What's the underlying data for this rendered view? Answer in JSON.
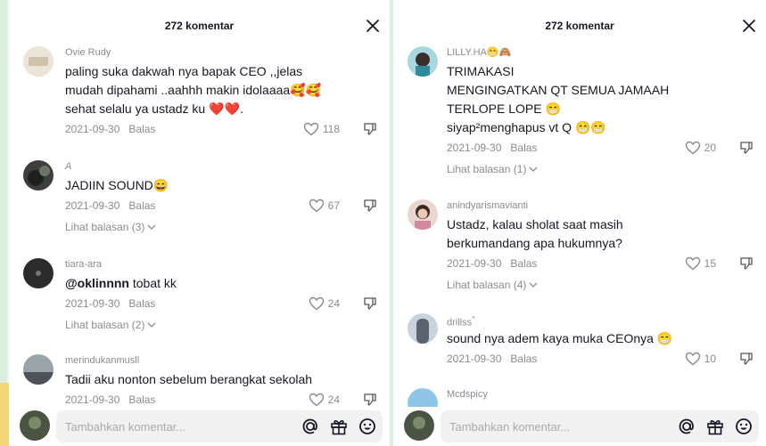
{
  "colors": {
    "accent": "#fe2c55",
    "text": "#161823",
    "muted": "#8a8b91",
    "input_bg": "#f1f1f2"
  },
  "left_panel": {
    "header_count": "272 komentar",
    "comments": [
      {
        "username": "Ovie Rudy",
        "lines": [
          "paling suka dakwah nya bapak CEO ,,jelas",
          "mudah dipahami ..aahhh makin idolaaaa🥰🥰",
          "sehat selalu ya ustadz ku ❤️❤️."
        ],
        "date": "2021-09-30",
        "reply": "Balas",
        "likes": "118"
      },
      {
        "username": "A",
        "lines": [
          "JADIIN SOUND😄"
        ],
        "date": "2021-09-30",
        "reply": "Balas",
        "likes": "67",
        "view_replies": "Lihat balasan (3)"
      },
      {
        "username": "tiara-ara",
        "mention": "@oklinnnn",
        "lines": [
          " tobat kk"
        ],
        "date": "2021-09-30",
        "reply": "Balas",
        "likes": "24",
        "view_replies": "Lihat balasan (2)"
      },
      {
        "username": "merindukanmusll",
        "lines": [
          "Tadii aku nonton sebelum berangkat sekolah"
        ],
        "date": "2021-09-30",
        "reply": "Balas",
        "likes": "24"
      }
    ],
    "input_placeholder": "Tambahkan komentar..."
  },
  "right_panel": {
    "header_count": "272 komentar",
    "comments": [
      {
        "username": "LILLY.HA",
        "username_emoji": "😁🙈",
        "lines": [
          "TRIMAKASI",
          "MENGINGATKAN QT SEMUA JAMAAH",
          "TERLOPE LOPE 😁",
          "siyap²menghapus vt Q 😁😁"
        ],
        "date": "2021-09-30",
        "reply": "Balas",
        "likes": "20",
        "view_replies": "Lihat balasan (1)"
      },
      {
        "username": "anindyarismavianti",
        "lines": [
          "Ustadz, kalau sholat saat masih",
          "berkumandang apa hukumnya?"
        ],
        "date": "2021-09-30",
        "reply": "Balas",
        "likes": "15",
        "view_replies": "Lihat balasan (4)"
      },
      {
        "username": "drillss",
        "username_suffix": "^",
        "lines": [
          "sound nya adem kaya muka CEOnya 😁"
        ],
        "date": "2021-09-30",
        "reply": "Balas",
        "likes": "10"
      },
      {
        "username": "Mcdspicy"
      }
    ],
    "input_placeholder": "Tambahkan komentar..."
  }
}
